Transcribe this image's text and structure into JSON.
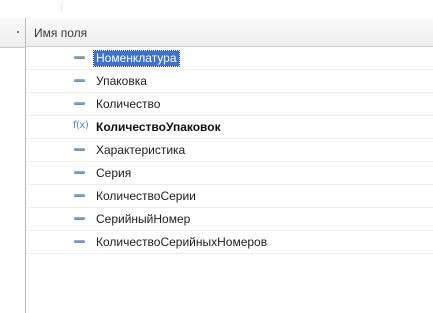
{
  "grid": {
    "header": {
      "column_title": "Имя поля"
    },
    "rows": [
      {
        "icon": "field-icon",
        "label": "Номенклатура",
        "selected": true,
        "bold": false
      },
      {
        "icon": "field-icon",
        "label": "Упаковка",
        "selected": false,
        "bold": false
      },
      {
        "icon": "field-icon",
        "label": "Количество",
        "selected": false,
        "bold": false
      },
      {
        "icon": "function-icon",
        "icon_text": "f(x)",
        "label": "КоличествоУпаковок",
        "selected": false,
        "bold": true
      },
      {
        "icon": "field-icon",
        "label": "Характеристика",
        "selected": false,
        "bold": false
      },
      {
        "icon": "field-icon",
        "label": "Серия",
        "selected": false,
        "bold": false
      },
      {
        "icon": "field-icon",
        "label": "КоличествоСерии",
        "selected": false,
        "bold": false
      },
      {
        "icon": "field-icon",
        "label": "СерийныйНомер",
        "selected": false,
        "bold": false
      },
      {
        "icon": "field-icon",
        "label": "КоличествоСерийныхНомеров",
        "selected": false,
        "bold": false
      }
    ]
  },
  "colors": {
    "selection": "#3f73c8",
    "field_icon": "#7f98ae",
    "function_icon": "#6a7f97"
  }
}
